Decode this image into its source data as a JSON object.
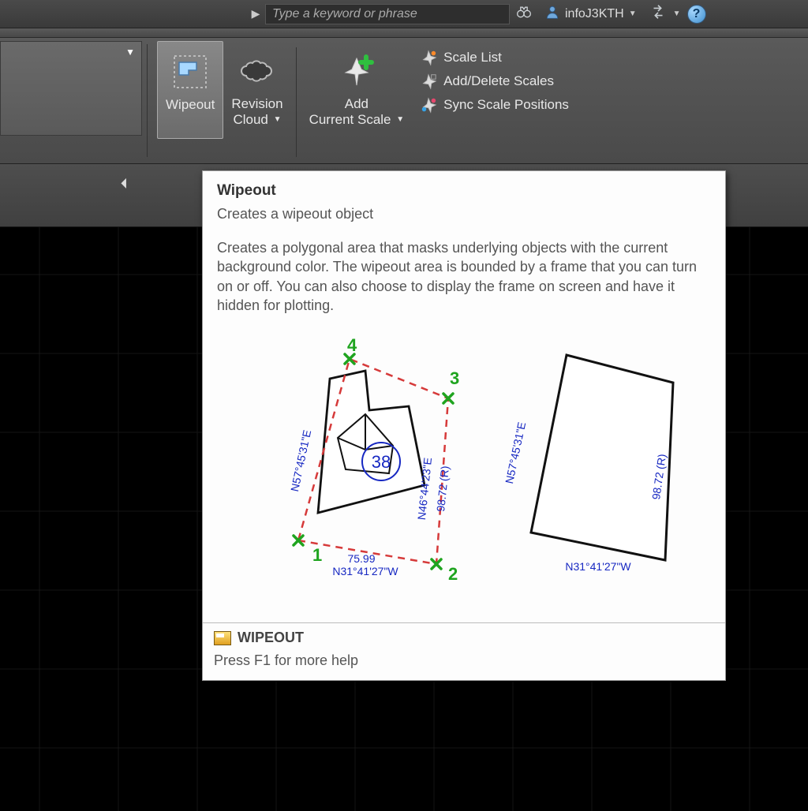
{
  "titlebar": {
    "search_placeholder": "Type a keyword or phrase",
    "username": "infoJ3KTH"
  },
  "ribbon": {
    "wipeout_label": "Wipeout",
    "revision_cloud_label_l1": "Revision",
    "revision_cloud_label_l2": "Cloud",
    "add_scale_l1": "Add",
    "add_scale_l2": "Current Scale",
    "scale_list": "Scale List",
    "add_delete_scales": "Add/Delete Scales",
    "sync_scale": "Sync Scale Positions"
  },
  "tooltip": {
    "title": "Wipeout",
    "short": "Creates a wipeout object",
    "long": "Creates a polygonal area that masks underlying objects with the current background color. The wipeout area is bounded by a frame that you can turn on or off. You can also choose to display the frame on screen and have it hidden for plotting.",
    "command": "WIPEOUT",
    "help_hint": "Press F1 for more help",
    "diagram": {
      "points": [
        "1",
        "2",
        "3",
        "4"
      ],
      "dim_bottom": "75.99",
      "bearing_bottom": "N31°41'27\"W",
      "bearing_left": "N57°45'31\"E",
      "bearing_right": "N46°44'23\"E",
      "dist_right": "98.72 (R)",
      "lot_num": "38"
    }
  },
  "colors": {
    "accent_green": "#1fa41f",
    "dim_blue": "#1728c2",
    "dash_red": "#d63a3a"
  }
}
